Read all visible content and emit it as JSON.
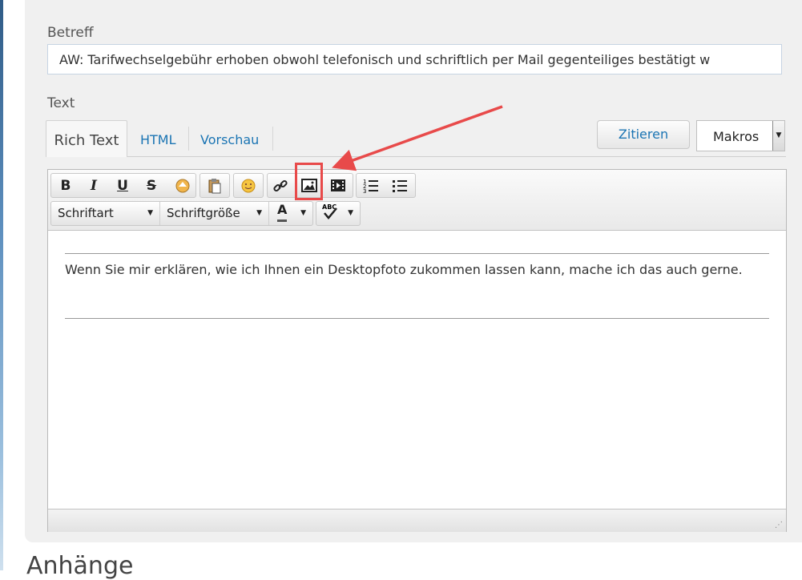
{
  "subject": {
    "label": "Betreff",
    "value": "AW: Tarifwechselgebühr erhoben obwohl telefonisch und schriftlich per Mail gegenteiliges bestätigt w"
  },
  "text_section": {
    "label": "Text",
    "tabs": [
      {
        "label": "Rich Text",
        "active": true
      },
      {
        "label": "HTML",
        "active": false
      },
      {
        "label": "Vorschau",
        "active": false
      }
    ],
    "quote_button": "Zitieren",
    "macros_select": "Makros"
  },
  "toolbar": {
    "font_combo": "Schriftart",
    "size_combo": "Schriftgröße",
    "buttons": [
      "bold-icon",
      "italic-icon",
      "underline-icon",
      "strikethrough-icon",
      "clear-format-icon",
      "paste-icon",
      "smiley-icon",
      "link-icon",
      "image-icon",
      "video-icon",
      "ordered-list-icon",
      "bullet-list-icon",
      "font-color-icon",
      "spellcheck-icon"
    ]
  },
  "editor": {
    "body": " Wenn Sie mir erklären, wie ich Ihnen ein Desktopfoto zukommen lassen kann, mache ich das auch gerne."
  },
  "attachments": {
    "heading": "Anhänge"
  },
  "colors": {
    "link": "#1a74b3",
    "annotation": "#e84a4a"
  }
}
